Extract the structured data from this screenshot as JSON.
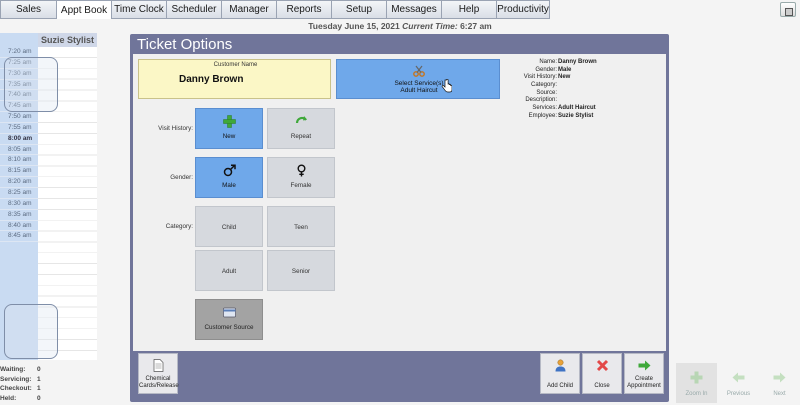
{
  "nav": {
    "tabs": [
      "Sales",
      "Appt Book",
      "Time Clock",
      "Scheduler",
      "Manager",
      "Reports",
      "Setup",
      "Messages",
      "Help",
      "Productivity"
    ],
    "active": "Appt Book"
  },
  "datebar": {
    "date": "Tuesday June 15, 2021",
    "time_label": "Current Time:",
    "time": "6:27 am"
  },
  "schedule": {
    "stylist": "Suzie Stylist",
    "times": [
      "7:20 am",
      "7:25 am",
      "7:30 am",
      "7:35 am",
      "7:40 am",
      "7:45 am",
      "7:50 am",
      "7:55 am",
      "8:00 am",
      "8:05 am",
      "8:10 am",
      "8:15 am",
      "8:20 am",
      "8:25 am",
      "8:30 am",
      "8:35 am",
      "8:40 am",
      "8:45 am"
    ]
  },
  "stats": [
    {
      "k": "Waiting:",
      "v": "0"
    },
    {
      "k": "Servicing:",
      "v": "1"
    },
    {
      "k": "Checkout:",
      "v": "1"
    },
    {
      "k": "Held:",
      "v": "0"
    }
  ],
  "dialog": {
    "title": "Ticket Options",
    "customer_label": "Customer Name",
    "customer_name": "Danny Brown",
    "service_title": "Select Service(s)",
    "service_value": "Adult Haircut",
    "info": [
      {
        "k": "Name:",
        "v": "Danny Brown"
      },
      {
        "k": "Gender:",
        "v": "Male"
      },
      {
        "k": "Visit History:",
        "v": "New"
      },
      {
        "k": "Category:",
        "v": ""
      },
      {
        "k": "Source:",
        "v": ""
      },
      {
        "k": "Description:",
        "v": ""
      },
      {
        "k": "Services:",
        "v": "Adult Haircut"
      },
      {
        "k": "Employee:",
        "v": "Suzie Stylist"
      }
    ],
    "labels": {
      "visit": "Visit History:",
      "gender": "Gender:",
      "category": "Category:"
    },
    "buttons": {
      "new": "New",
      "repeat": "Repeat",
      "male": "Male",
      "female": "Female",
      "child": "Child",
      "teen": "Teen",
      "adult": "Adult",
      "senior": "Senior",
      "source": "Customer Source"
    },
    "footer": {
      "chemical_l1": "Chemical",
      "chemical_l2": "Cards/Release",
      "add_child": "Add Child",
      "close": "Close",
      "create_l1": "Create",
      "create_l2": "Appointment"
    }
  },
  "zoom": {
    "zoom_in": "Zoom In",
    "previous": "Previous",
    "next": "Next"
  },
  "colors": {
    "dialog": "#70759a",
    "selected": "#6fa8ea",
    "customer_box": "#fbf7c6"
  }
}
